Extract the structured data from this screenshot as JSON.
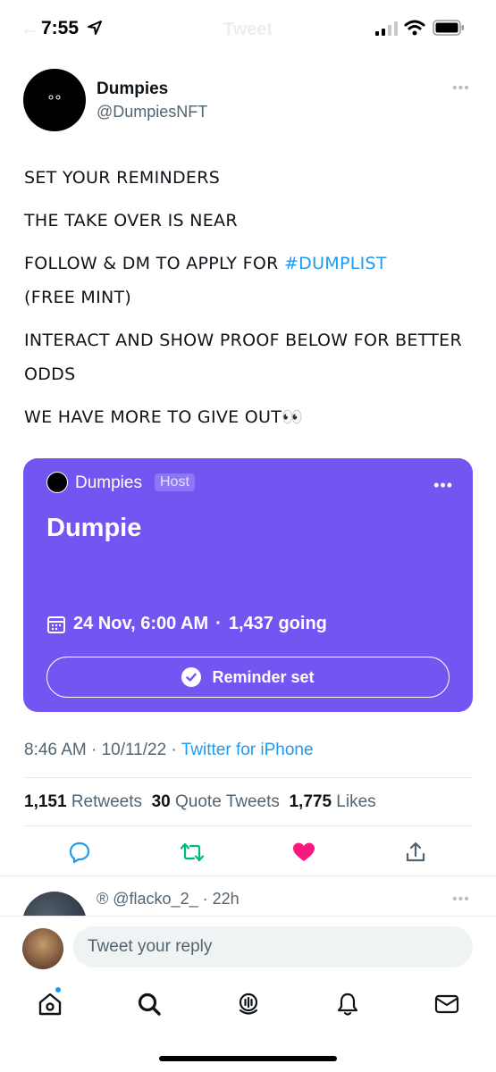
{
  "status_bar": {
    "time": "7:55",
    "nav_title": "Tweet"
  },
  "author": {
    "name": "Dumpies",
    "handle": "@DumpiesNFT"
  },
  "tweet": {
    "lines": [
      "SET YOUR REMINDERS",
      "THE TAKE OVER IS NEAR",
      "FOLLOW & DM TO APPLY FOR ",
      "(FREE MINT)",
      "INTERACT AND SHOW PROOF BELOW FOR BETTER ODDS",
      "WE HAVE MORE TO GIVE OUT👀"
    ],
    "hashtag": "#DUMPLIST"
  },
  "space_card": {
    "host_name": "Dumpies",
    "host_badge": "Host",
    "title": "Dumpie",
    "date": "24 Nov, 6:00 AM",
    "separator": "·",
    "going": "1,437 going",
    "reminder_label": "Reminder set",
    "bg_color": "#7356f1"
  },
  "meta": {
    "time": "8:46 AM",
    "date": "10/11/22",
    "source": "Twitter for iPhone"
  },
  "stats": {
    "retweets_count": "1,151",
    "retweets_label": "Retweets",
    "quotes_count": "30",
    "quotes_label": "Quote Tweets",
    "likes_count": "1,775",
    "likes_label": "Likes"
  },
  "actions": [
    "reply-icon",
    "retweet-icon",
    "like-icon",
    "share-icon"
  ],
  "reply_preview": {
    "handle": "® @flacko_2_ · 22h"
  },
  "reply_bar": {
    "placeholder": "Tweet your reply"
  },
  "tabs": [
    "home-icon",
    "search-icon",
    "spaces-icon",
    "notifications-icon",
    "messages-icon"
  ],
  "colors": {
    "accent": "#1d9bf0",
    "retweet_green": "#00ba7c",
    "like_pink": "#f91880"
  }
}
